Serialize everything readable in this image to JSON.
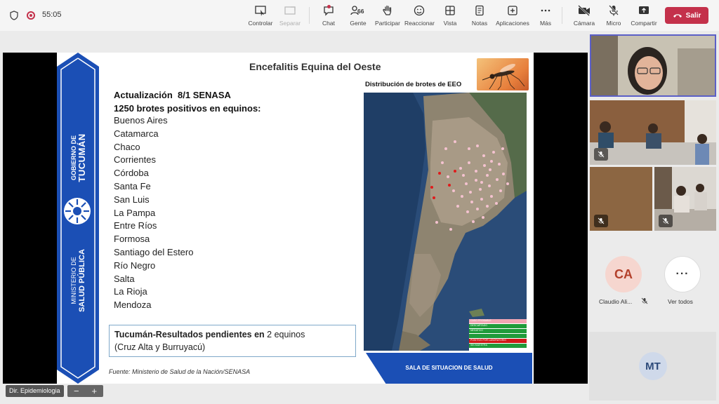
{
  "meeting": {
    "timer": "55:05"
  },
  "toolbar": {
    "controlar": "Controlar",
    "separar": "Separar",
    "chat": "Chat",
    "people_count": "66",
    "gente": "Gente",
    "participar": "Participar",
    "reaccionar": "Reaccionar",
    "vista": "Vista",
    "notas": "Notas",
    "aplicaciones": "Aplicaciones",
    "mas": "Más",
    "camara": "Cámara",
    "micro": "Micro",
    "compartir": "Compartir",
    "salir": "Salir",
    "icons": [
      "shield-icon",
      "record-icon",
      "control-icon",
      "separate-icon",
      "chat-icon",
      "people-icon",
      "raise-hand-icon",
      "reaction-icon",
      "view-icon",
      "notes-icon",
      "apps-icon",
      "more-icon",
      "camera-off-icon",
      "mic-off-icon",
      "share-icon",
      "phone-hangup-icon"
    ],
    "leave_color": "#c4314b"
  },
  "slide": {
    "banner": {
      "gobierno": "GOBIERNO DE",
      "tucuman": "TUCUMÁN",
      "ministerio": "MINISTERIO DE",
      "salud": "SALUD PÚBLICA",
      "color": "#1b4fb5"
    },
    "title": "Encefalitis Equina del Oeste",
    "update_line": "Actualización  8/1 SENASA",
    "outbreaks_line": "1250 brotes positivos en equinos:",
    "provinces": [
      "Buenos Aires",
      "Catamarca",
      "Chaco",
      "Corrientes",
      "Córdoba",
      "Santa Fe",
      "San Luis",
      "La Pampa",
      "Entre Ríos",
      "Formosa",
      "Santiago del Estero",
      "Río Negro",
      "Salta",
      "La Rioja",
      "Mendoza"
    ],
    "pending_bold": "Tucumán-Resultados pendientes en",
    "pending_rest": " 2 equinos",
    "pending_detail": "(Cruz Alta y Burruyacú)",
    "source": "Fuente: Ministerio de Salud de la Nación/SENASA",
    "map_title": "Distribución de brotes de EEO",
    "map_legend": [
      {
        "label": "CASO PROBABLE",
        "color": "#f2a6b4"
      },
      {
        "label": "DESCARTADO",
        "color": "#1f9b3a"
      },
      {
        "label": "NEGATIVO",
        "color": "#1f9b3a"
      },
      {
        "label": "",
        "color": "#1f9b3a"
      },
      {
        "label": "POSITIVO POR LABORATORIO",
        "color": "#d01818"
      },
      {
        "label": "SIN MUESTRA",
        "color": "#1f9b3a"
      }
    ],
    "footer_box": "SALA DE SITUACION  DE SALUD"
  },
  "gallery": {
    "participant_ca": {
      "initials": "CA",
      "name": "Claudio Ali..."
    },
    "ver_todos": "Ver todos",
    "participant_mt": {
      "initials": "MT"
    }
  },
  "bottom": {
    "screen_label": "Dir. Epidemiologia",
    "zoom_out": "−",
    "zoom_in": "+"
  }
}
